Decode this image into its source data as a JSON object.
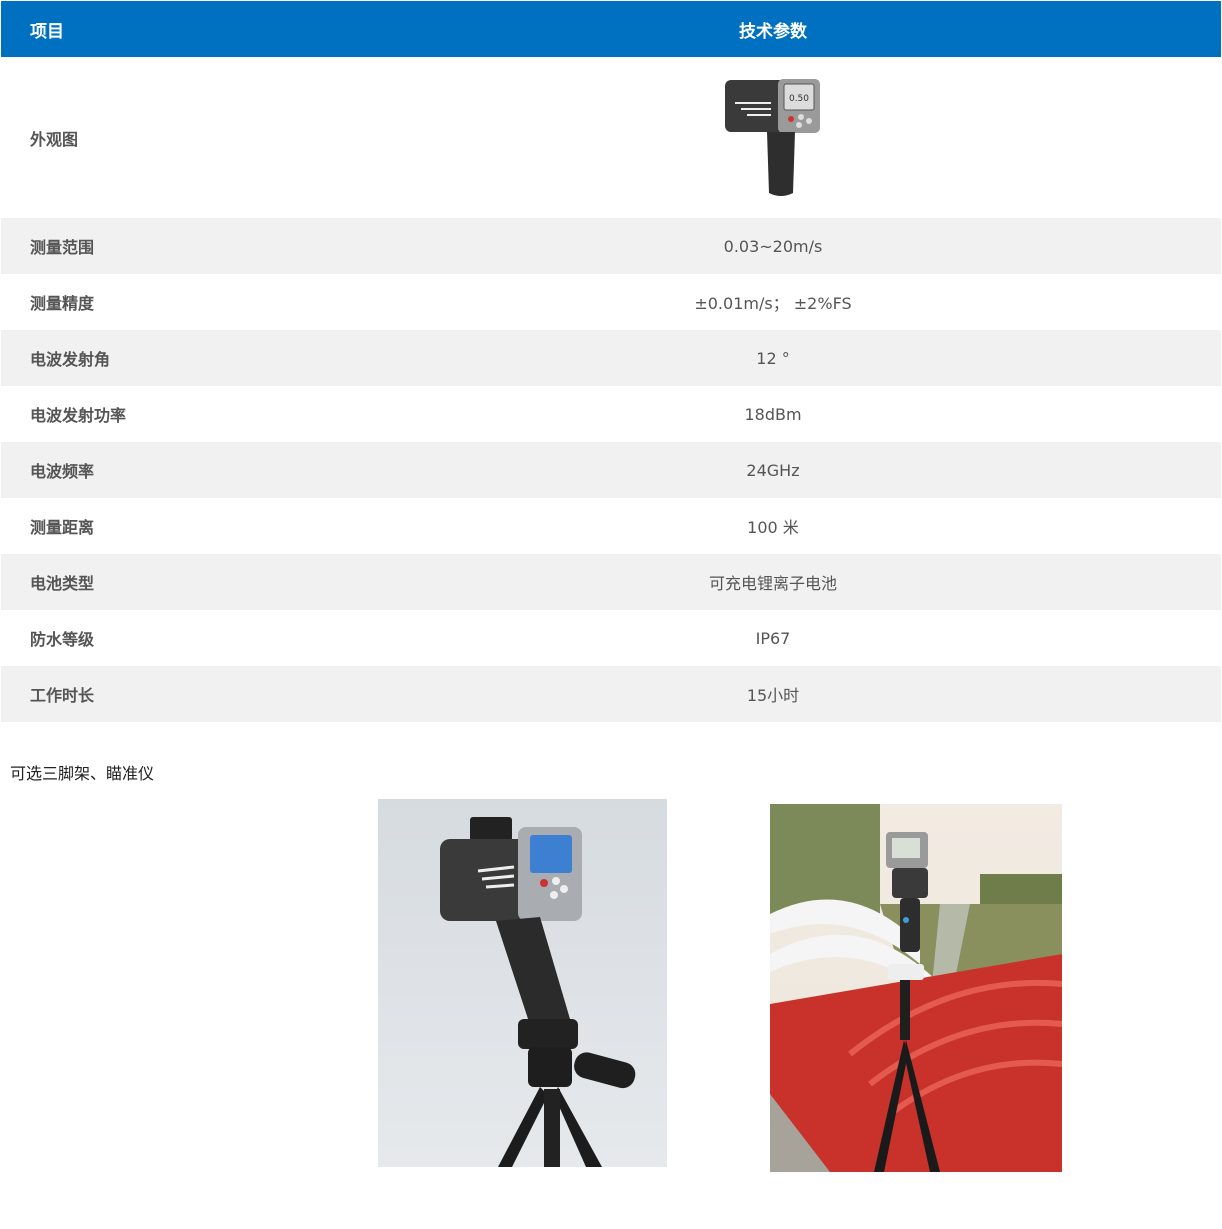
{
  "table": {
    "header": {
      "item": "项目",
      "value": "技术参数"
    },
    "photo_row_label": "外观图",
    "device_screen_value": "0.50",
    "rows": [
      {
        "label": "测量范围",
        "value": "0.03~20m/s"
      },
      {
        "label": "测量精度",
        "value": "±0.01m/s； ±2%FS"
      },
      {
        "label": "电波发射角",
        "value": "12 °"
      },
      {
        "label": "电波发射功率",
        "value": "18dBm"
      },
      {
        "label": "电波频率",
        "value": "24GHz"
      },
      {
        "label": "测量距离",
        "value": "100 米"
      },
      {
        "label": "电池类型",
        "value": "可充电锂离子电池"
      },
      {
        "label": "防水等级",
        "value": "IP67"
      },
      {
        "label": "工作时长",
        "value": "15小时"
      }
    ]
  },
  "caption": "可选三脚架、瞄准仪",
  "colors": {
    "header_bg": "#0070c0",
    "stripe_bg": "#f1f1f1",
    "text": "#555555"
  }
}
